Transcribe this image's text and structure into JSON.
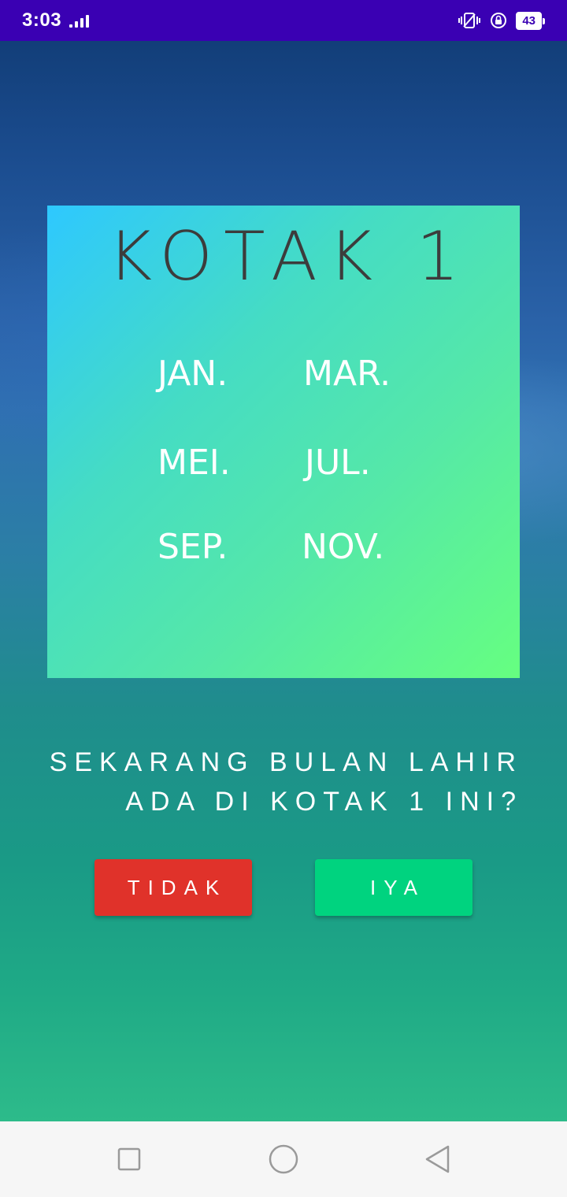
{
  "status_bar": {
    "time": "3:03",
    "battery": "43",
    "icons": [
      "signal-icon",
      "vibrate-icon",
      "rotation-lock-icon",
      "battery-icon"
    ]
  },
  "card": {
    "title": "KOTAK 1",
    "months": [
      "JAN.",
      "MAR.",
      "MEI.",
      "JUL.",
      "SEP.",
      "NOV."
    ]
  },
  "question": {
    "line1": "SEKARANG BULAN LAHIR",
    "line2": "ADA DI KOTAK 1 INI?"
  },
  "buttons": {
    "no_label": "TIDAK",
    "yes_label": "IYA"
  },
  "colors": {
    "status_bar": "#3a00b3",
    "button_no": "#e0322a",
    "button_yes": "#00d37f",
    "card_gradient_start": "#2ec8ff",
    "card_gradient_end": "#66ff80",
    "title_text": "#3c3c3c"
  },
  "nav_bar": {
    "icons": [
      "recent-apps-icon",
      "home-icon",
      "back-icon"
    ]
  }
}
